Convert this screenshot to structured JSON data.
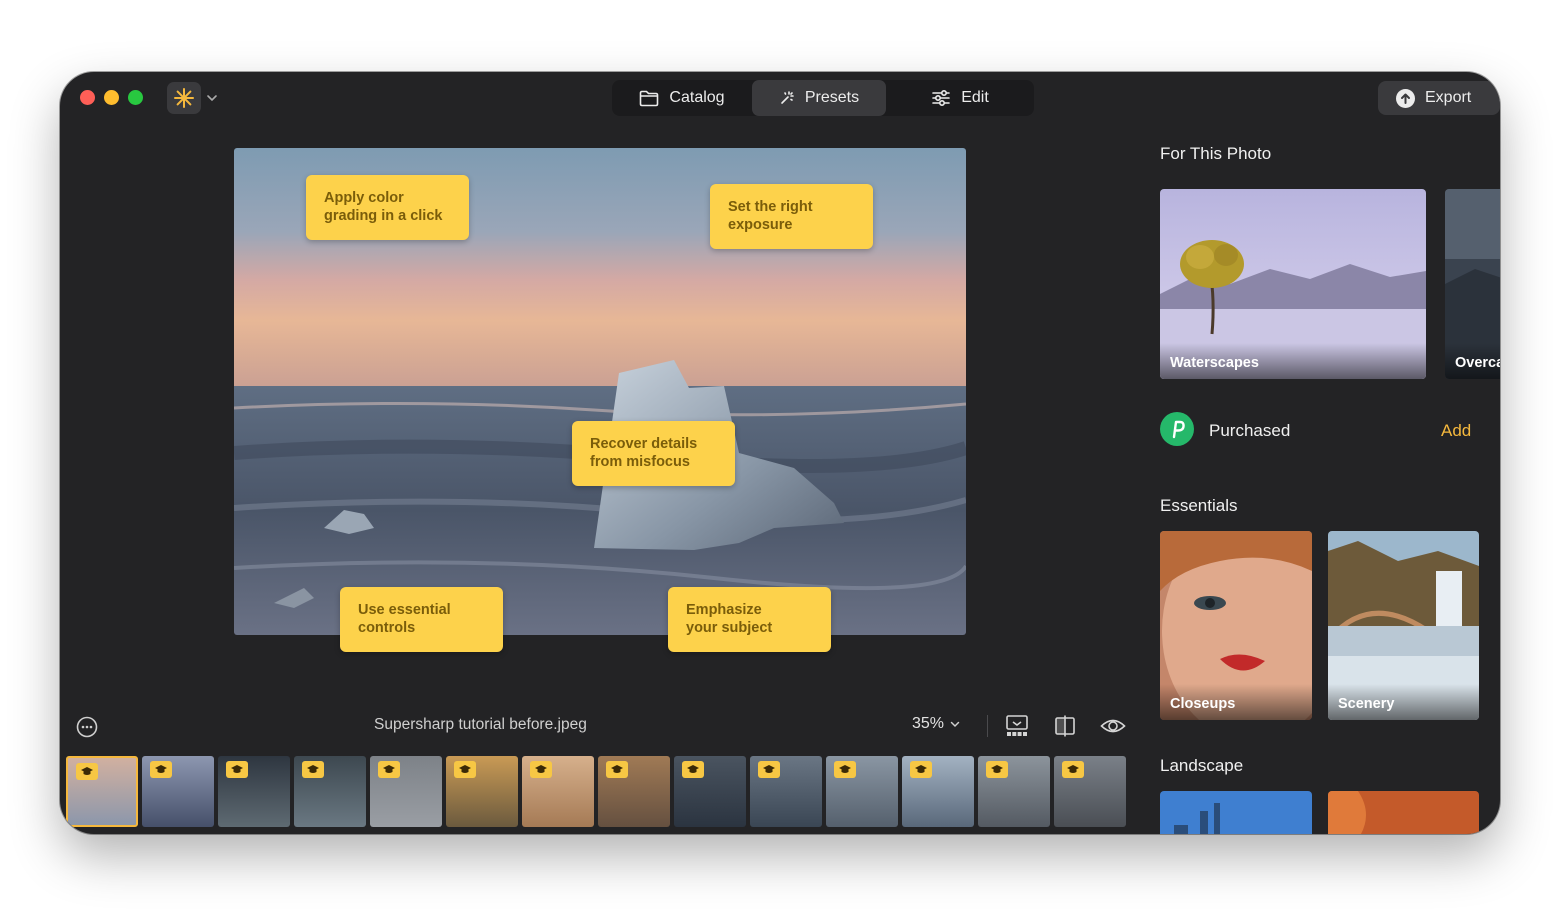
{
  "toolbar": {
    "tabs": [
      {
        "label": "Catalog",
        "icon": "folder-icon",
        "active": false
      },
      {
        "label": "Presets",
        "icon": "sparkle-icon",
        "active": true
      },
      {
        "label": "Edit",
        "icon": "sliders-icon",
        "active": false
      }
    ],
    "export_label": "Export"
  },
  "callouts": [
    {
      "line1": "Apply color",
      "line2": "grading in a click"
    },
    {
      "line1": "Set the right",
      "line2": "exposure"
    },
    {
      "line1": "Recover details",
      "line2": "from misfocus"
    },
    {
      "line1": "Use essential",
      "line2": "controls"
    },
    {
      "line1": "Emphasize",
      "line2": "your subject"
    }
  ],
  "bottom_bar": {
    "filename": "Supersharp tutorial before.jpeg",
    "zoom": "35%"
  },
  "filmstrip": {
    "thumbnail_count": 14,
    "selected_index": 0
  },
  "right_panel": {
    "for_this_photo": {
      "title": "For This Photo",
      "cards": [
        "Waterscapes",
        "Overca"
      ]
    },
    "purchased": {
      "label": "Purchased",
      "action": "Add"
    },
    "essentials": {
      "title": "Essentials",
      "cards": [
        "Closeups",
        "Scenery"
      ]
    },
    "landscape": {
      "title": "Landscape"
    }
  },
  "colors": {
    "accent": "#f5b83d",
    "callout": "#fdd24b",
    "window_bg": "#232325",
    "purchased_green": "#25b86a"
  }
}
